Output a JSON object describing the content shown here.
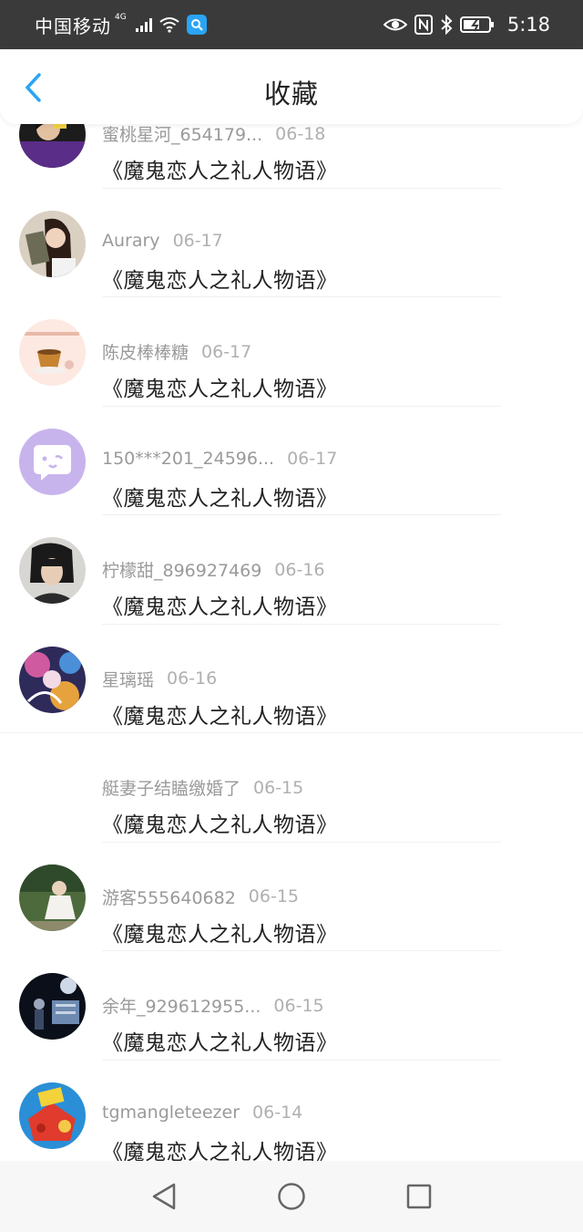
{
  "status_bar": {
    "carrier": "中国移动",
    "network": "4G",
    "time": "5:18"
  },
  "header": {
    "title": "收藏",
    "back_icon": "chevron-left-icon"
  },
  "colors": {
    "status_bar_bg": "#3a3a3a",
    "accent": "#2aa4f4",
    "meta_text": "#9a9a9a",
    "title_text": "#222222"
  },
  "items": [
    {
      "name": "蜜桃星河_654179...",
      "date": "06-18",
      "book": "《魔鬼恋人之礼人物语》",
      "avatar": "photo"
    },
    {
      "name": "Aurary",
      "date": "06-17",
      "book": "《魔鬼恋人之礼人物语》",
      "avatar": "photo"
    },
    {
      "name": "陈皮棒棒糖",
      "date": "06-17",
      "book": "《魔鬼恋人之礼人物语》",
      "avatar": "photo"
    },
    {
      "name": "150***201_24596...",
      "date": "06-17",
      "book": "《魔鬼恋人之礼人物语》",
      "avatar": "default-chat-avatar"
    },
    {
      "name": "柠檬甜_896927469",
      "date": "06-16",
      "book": "《魔鬼恋人之礼人物语》",
      "avatar": "photo"
    },
    {
      "name": "星璃瑶",
      "date": "06-16",
      "book": "《魔鬼恋人之礼人物语》",
      "avatar": "photo"
    },
    {
      "name": "艇妻子结瞌缴婚了",
      "date": "06-15",
      "book": "《魔鬼恋人之礼人物语》",
      "avatar": "none"
    },
    {
      "name": "游客555640682",
      "date": "06-15",
      "book": "《魔鬼恋人之礼人物语》",
      "avatar": "photo"
    },
    {
      "name": "余年_929612955...",
      "date": "06-15",
      "book": "《魔鬼恋人之礼人物语》",
      "avatar": "photo"
    },
    {
      "name": "tgmangleteezer",
      "date": "06-14",
      "book": "《魔鬼恋人之礼人物语》",
      "avatar": "photo"
    }
  ],
  "nav": {
    "back": "triangle-back-icon",
    "home": "circle-home-icon",
    "recents": "square-recents-icon"
  }
}
